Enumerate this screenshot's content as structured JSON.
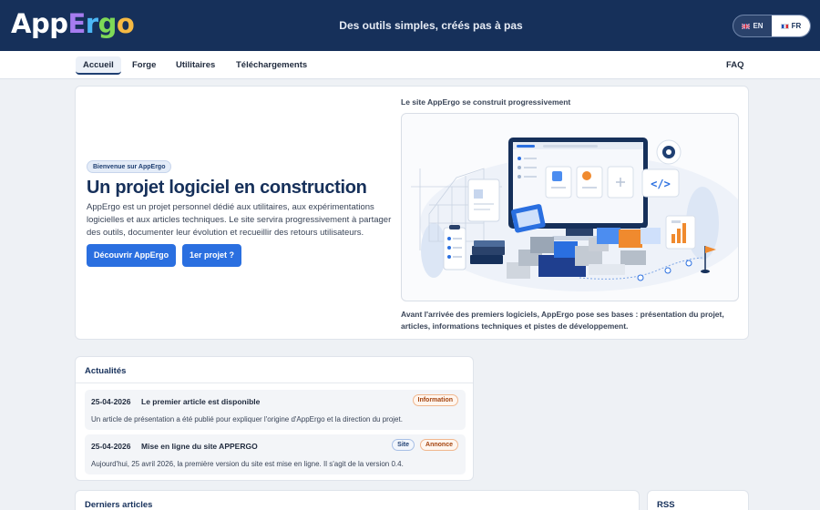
{
  "header": {
    "logo_parts": [
      "App",
      "E",
      "r",
      "g",
      "o"
    ],
    "logo_colors": [
      "#ffffff",
      "#a67cf0",
      "#4cb7f5",
      "#7ed957",
      "#f5b943"
    ],
    "tagline": "Des outils simples, créés pas à pas",
    "languages": [
      {
        "code": "EN",
        "flag": "flag-uk-icon",
        "active": false
      },
      {
        "code": "FR",
        "flag": "flag-fr-icon",
        "active": true
      }
    ]
  },
  "nav": {
    "items": [
      "Accueil",
      "Forge",
      "Utilitaires",
      "Téléchargements"
    ],
    "active": "Accueil",
    "right": "FAQ"
  },
  "hero": {
    "badge": "Bienvenue sur AppErgo",
    "title": "Un projet logiciel en construction",
    "text": "AppErgo est un projet personnel dédié aux utilitaires, aux expérimentations logicielles et aux articles techniques. Le site servira progressivement à partager des outils, documenter leur évolution et recueillir des retours utilisateurs.",
    "primary_button": "Découvrir AppErgo",
    "secondary_button": "1er projet ?",
    "illustration_caption_top": "Le site AppErgo se construit progressivement",
    "illustration_caption_bottom": "Avant l'arrivée des premiers logiciels, AppErgo pose ses bases : présentation du projet, articles, informations techniques et pistes de développement."
  },
  "news": {
    "title": "Actualités",
    "items": [
      {
        "date": "25-04-2026",
        "title": "Le premier article est disponible",
        "description": "Un article de présentation a été publié pour expliquer l'origine d'AppErgo et la direction du projet.",
        "tags": [
          "Information"
        ]
      },
      {
        "date": "25-04-2026",
        "title": "Mise en ligne du site APPERGO",
        "description": "Aujourd'hui, 25 avril 2026, la première version du site est mise en ligne. Il s'agit de la version 0.4.",
        "tags": [
          "Site",
          "Annonce"
        ]
      }
    ]
  },
  "articles": {
    "title": "Derniers articles"
  },
  "rss": {
    "title": "RSS"
  },
  "colors": {
    "header_bg": "#16305a",
    "accent": "#2a6fe0",
    "page_bg": "#eef1f5"
  }
}
